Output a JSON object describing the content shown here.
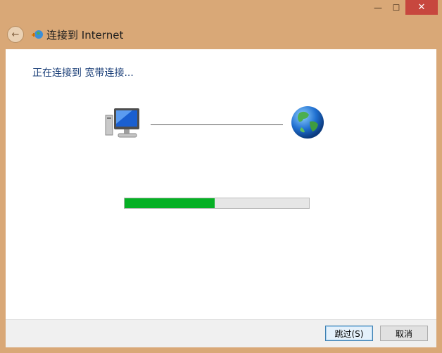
{
  "window": {
    "minimize_glyph": "—",
    "maximize_glyph": "☐",
    "close_glyph": "✕"
  },
  "nav": {
    "back_glyph": "←",
    "title": "连接到 Internet"
  },
  "main": {
    "status": "正在连接到 宽带连接..."
  },
  "progress": {
    "value": 0.49
  },
  "buttons": {
    "skip": "跳过(S)",
    "cancel": "取消"
  },
  "colors": {
    "progress_fill": "#06b025",
    "status_text": "#1b3f78",
    "frame": "#d9a877"
  }
}
